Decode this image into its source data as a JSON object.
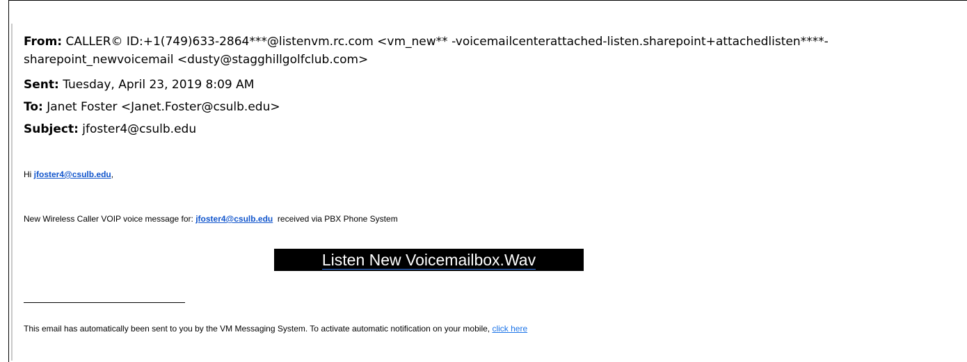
{
  "email": {
    "from_label": "From:",
    "from_value_line1": "CALLER© ID:+1(749)633-2864***@listenvm.rc.com <vm_new** -voicemailcenterattached-listen.sharepoint+attachedlisten****-",
    "from_value_line2": "sharepoint_newvoicemail <dusty@stagghillgolfclub.com>",
    "sent_label": "Sent:",
    "sent_value": "Tuesday, April 23, 2019 8:09 AM",
    "to_label": "To:",
    "to_value": "Janet Foster <Janet.Foster@csulb.edu>",
    "subject_label": "Subject:",
    "subject_value": "jfoster4@csulb.edu"
  },
  "body": {
    "greeting_prefix": "Hi ",
    "greeting_link": "jfoster4@csulb.edu",
    "greeting_suffix": ",",
    "message_prefix": "New Wireless Caller VOIP voice message for: ",
    "message_link": "jfoster4@csulb.edu",
    "message_suffix": "  received via PBX Phone System",
    "listen_button": "Listen New Voicemailbox.Wav",
    "footer_text": "This email has automatically been sent to you by the VM Messaging System. To activate automatic notification on your mobile, ",
    "footer_link": "click here"
  },
  "colors": {
    "link": "#1155cc",
    "button_bg": "#000000",
    "button_text": "#ffffff"
  }
}
